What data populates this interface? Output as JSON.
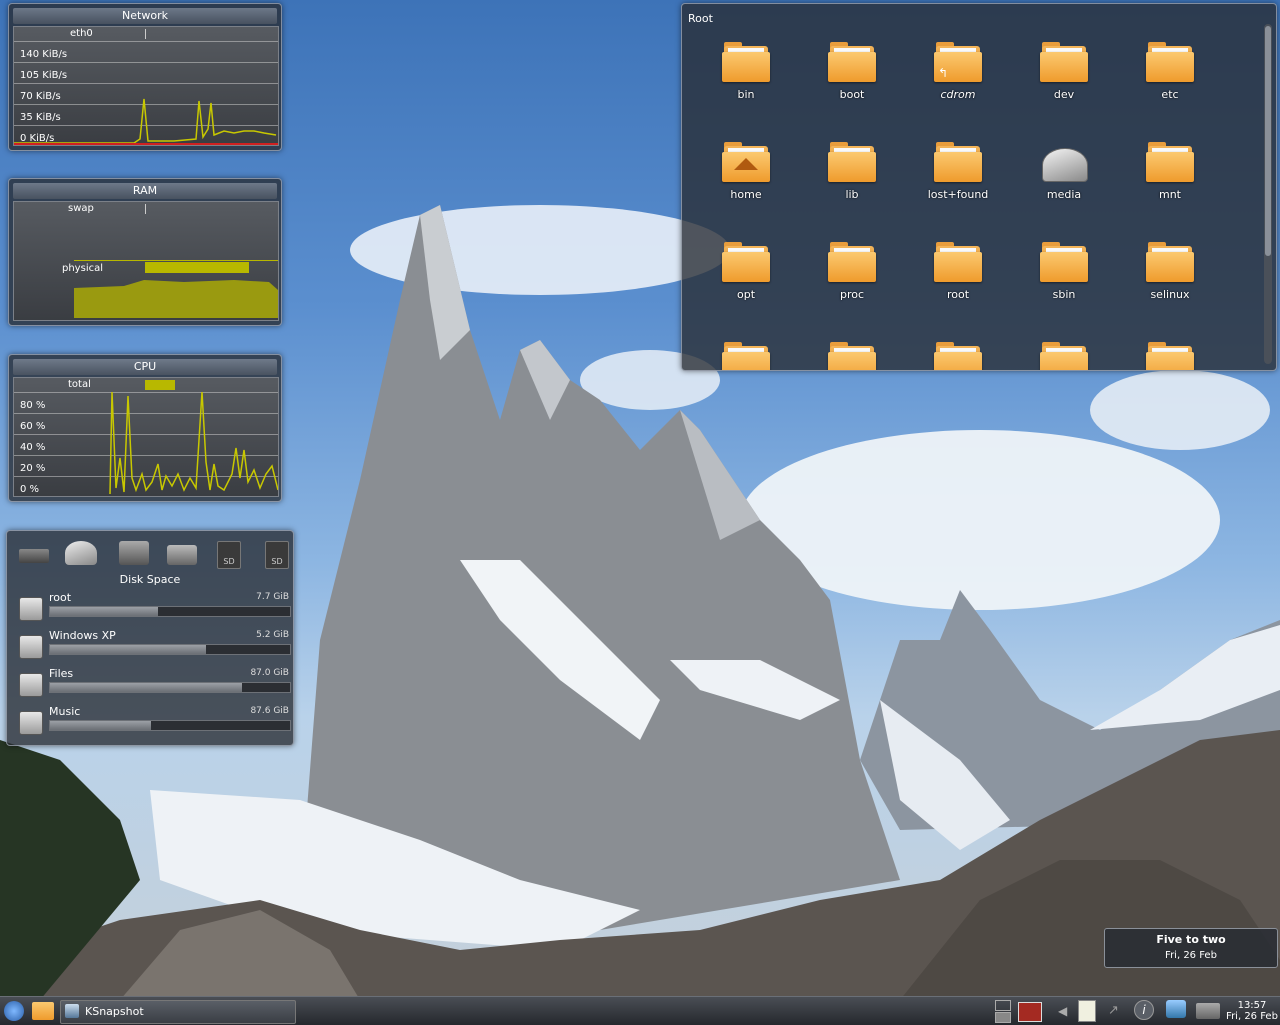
{
  "network": {
    "title": "Network",
    "interface": "eth0",
    "ticks": [
      "140 KiB/s",
      "105 KiB/s",
      "70 KiB/s",
      "35 KiB/s",
      "0 KiB/s"
    ]
  },
  "ram": {
    "title": "RAM",
    "swap_label": "swap",
    "physical_label": "physical"
  },
  "cpu": {
    "title": "CPU",
    "total_label": "total",
    "ticks": [
      "80 %",
      "60 %",
      "40 %",
      "20 %",
      "0 %"
    ]
  },
  "disks": {
    "title": "Disk Space",
    "items": [
      {
        "name": "root",
        "size": "7.7 GiB",
        "used": 0.45
      },
      {
        "name": "Windows XP",
        "size": "5.2 GiB",
        "used": 0.65
      },
      {
        "name": "Files",
        "size": "87.0 GiB",
        "used": 0.8
      },
      {
        "name": "Music",
        "size": "87.6 GiB",
        "used": 0.42
      }
    ]
  },
  "folderview": {
    "title": "Root",
    "items": [
      "bin",
      "boot",
      "cdrom",
      "dev",
      "etc",
      "home",
      "lib",
      "lost+found",
      "media",
      "mnt",
      "opt",
      "proc",
      "root",
      "sbin",
      "selinux"
    ]
  },
  "clock_popup": {
    "time_text": "Five to two",
    "date": "Fri, 26 Feb"
  },
  "taskbar": {
    "task_label": "KSnapshot",
    "time": "13:57",
    "date": "Fri, 26 Feb"
  },
  "colors": {
    "folder": "#f0a030",
    "graph_fill": "#b8b800",
    "panel": "#2c3036"
  }
}
